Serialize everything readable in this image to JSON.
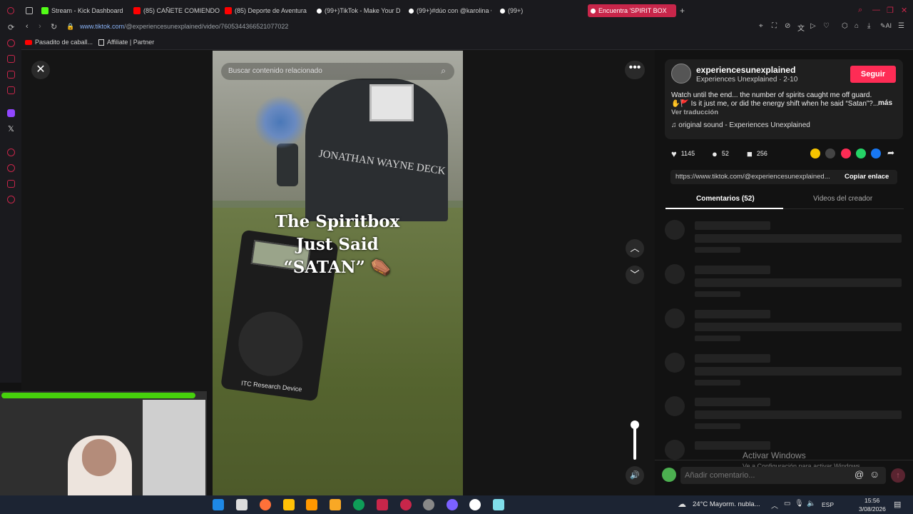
{
  "browser": {
    "tabs": [
      {
        "label": "",
        "color": "#888888"
      },
      {
        "label": "Stream - Kick Dashboard",
        "color": "#53fc18"
      },
      {
        "label": "(85) CAÑETE COMIENDO •",
        "color": "#ff0000"
      },
      {
        "label": "(85) Deporte de Aventura •",
        "color": "#ff0000"
      },
      {
        "label": "(99+)TikTok - Make Your D",
        "color": "#ffffff"
      },
      {
        "label": "(99+)#dúo con @karolina •",
        "color": "#ffffff"
      },
      {
        "label": "(99+)",
        "color": "#ffffff"
      },
      {
        "label": "Encuentra 'SPIRIT BOX",
        "color": "#ffffff"
      }
    ],
    "url_domain": "www.tiktok.com",
    "url_path": "/@experiencesunexplained/video/7605344366521077022",
    "bookmarks": [
      {
        "label": "Pasadito de caball...",
        "color": "#ff0000"
      },
      {
        "label": "Affiliate | Partner",
        "color": "#dddddd"
      }
    ]
  },
  "video": {
    "search_placeholder": "Buscar contenido relacionado",
    "overlay_line1": "The Spiritbox",
    "overlay_line2": "Just Said",
    "overlay_line3": "“SATAN” ⚰️",
    "stone_text": "JONATHAN WAYNE DECK",
    "device_label": "ITC Research Device"
  },
  "controls": {
    "close": "✕",
    "more": "•••",
    "up": "︿",
    "down": "﹀",
    "volume_icon": "🔊"
  },
  "author": {
    "username": "experiencesunexplained",
    "nickname": "Experiences Unexplained · 2-10",
    "follow_label": "Seguir",
    "desc_line1": "Watch until the end... the number of spirits caught me off guard.",
    "desc_line2": "✋🚩 Is it just me, or did the energy shift when he said “Satan”?...",
    "more_label": "más",
    "translate_label": "Ver traducción",
    "music": "♫  original sound - Experiences Unexplained"
  },
  "stats": {
    "likes": "1145",
    "comments": "52",
    "saves": "256"
  },
  "share": {
    "link": "https://www.tiktok.com/@experiencesunexplained...",
    "copy_label": "Copiar enlace",
    "colors": [
      "#f5c400",
      "#444444",
      "#fe2c55",
      "#25d366",
      "#1877f2"
    ]
  },
  "tabs": {
    "comments_label": "Comentarios (52)",
    "creator_label": "Videos del creador"
  },
  "comment_box": {
    "placeholder": "Añadir comentario...",
    "at": "@",
    "emoji": "☺",
    "send": "↑"
  },
  "watermark": {
    "line1": "Activar Windows",
    "line2": "Ve a Configuración para activar Windows."
  },
  "taskbar": {
    "weather": "24°C  Mayorm. nubla...",
    "lang": "ESP",
    "time": "15:56",
    "date": "3/08/2026",
    "app_colors": [
      "#1e88e5",
      "#dddddd",
      "#ff7139",
      "#ffc107",
      "#ff9800",
      "#f9a825",
      "#0f9d58",
      "#c8264a",
      "#c8264a",
      "#888888",
      "#7b61ff",
      "#ffffff",
      "#80deea"
    ]
  }
}
